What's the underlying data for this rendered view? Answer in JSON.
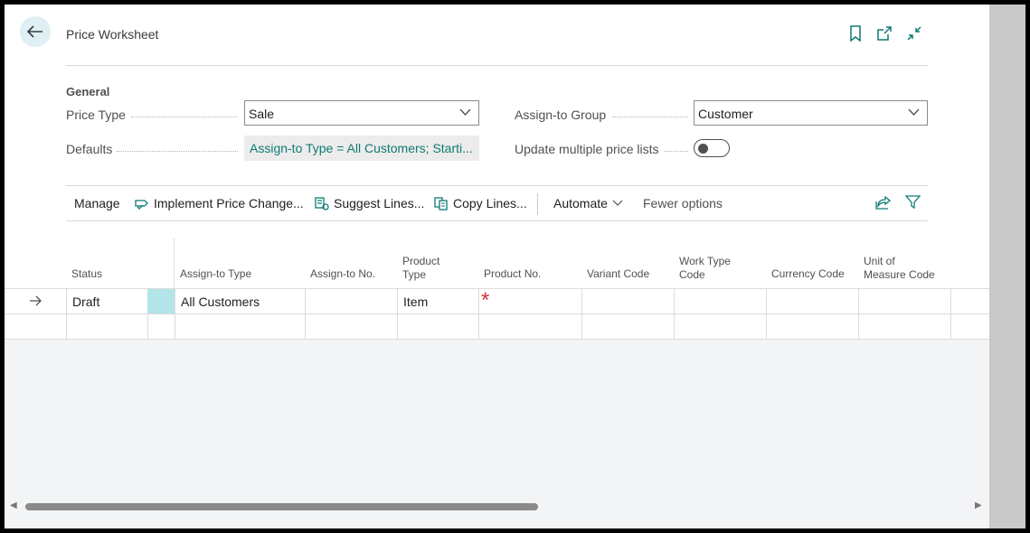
{
  "header": {
    "title": "Price Worksheet",
    "icons": [
      "back-arrow-icon",
      "bookmark-icon",
      "open-new-window-icon",
      "collapse-icon"
    ]
  },
  "general": {
    "section_title": "General",
    "price_type_label": "Price Type",
    "price_type_value": "Sale",
    "assign_to_group_label": "Assign-to Group",
    "assign_to_group_value": "Customer",
    "defaults_label": "Defaults",
    "defaults_value": "Assign-to Type = All Customers; Starti...",
    "update_multiple_label": "Update multiple price lists",
    "update_multiple_on": false
  },
  "actions": {
    "manage": "Manage",
    "implement": "Implement Price Change...",
    "suggest": "Suggest Lines...",
    "copy": "Copy Lines...",
    "automate": "Automate",
    "fewer": "Fewer options"
  },
  "grid": {
    "columns": {
      "status": "Status",
      "assign_to_type": "Assign-to Type",
      "assign_to_no": "Assign-to No.",
      "product_type_1": "Product",
      "product_type_2": "Type",
      "product_no": "Product No.",
      "variant_code": "Variant Code",
      "work_type_1": "Work Type",
      "work_type_2": "Code",
      "currency_code": "Currency Code",
      "uom_1": "Unit of",
      "uom_2": "Measure Code"
    },
    "row1": {
      "status": "Draft",
      "assign_to_type": "All Customers",
      "product_type": "Item",
      "product_no_required": "*"
    }
  },
  "colors": {
    "accent": "#0e7a74",
    "selection": "#b3e4e8",
    "required": "#d13438"
  }
}
